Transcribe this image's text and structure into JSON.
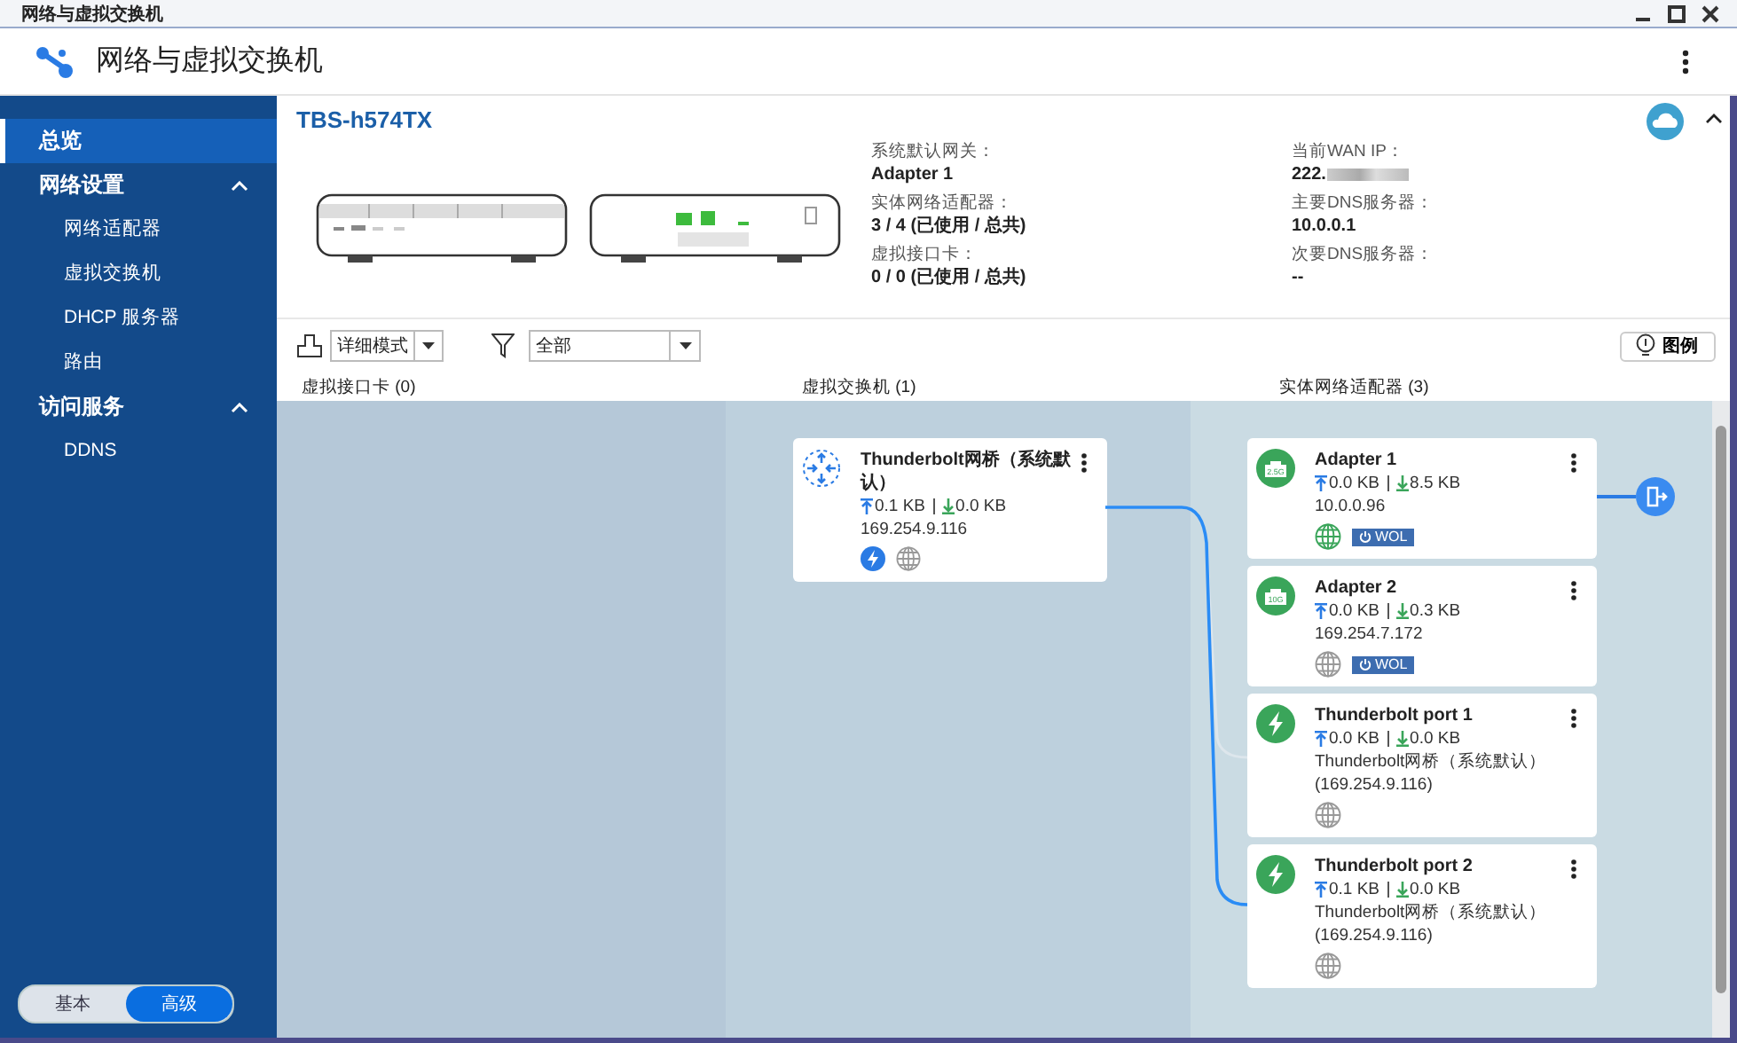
{
  "window": {
    "title": "网络与虚拟交换机"
  },
  "app": {
    "title": "网络与虚拟交换机"
  },
  "sidebar": {
    "items": [
      {
        "label": "总览",
        "selected": true
      },
      {
        "label": "网络设置",
        "selected": false,
        "expanded": true,
        "children": [
          {
            "label": "网络适配器",
            "selected": false
          },
          {
            "label": "虚拟交换机",
            "selected": false
          },
          {
            "label": "DHCP 服务器",
            "selected": false
          },
          {
            "label": "路由",
            "selected": false
          }
        ]
      },
      {
        "label": "访问服务",
        "selected": false,
        "expanded": true,
        "children": [
          {
            "label": "DDNS",
            "selected": false
          }
        ]
      }
    ],
    "mode_toggle": [
      {
        "label": "基本",
        "selected": false
      },
      {
        "label": "高级",
        "selected": true
      }
    ]
  },
  "device": {
    "name": "TBS-h574TX",
    "info": [
      {
        "label": "系统默认网关：",
        "value": "Adapter 1",
        "blurred": false
      },
      {
        "label": "当前WAN IP：",
        "value": "222.",
        "blurred": true
      },
      {
        "label": "实体网络适配器：",
        "value": "3 / 4 (已使用 / 总共)",
        "blurred": false
      },
      {
        "label": "主要DNS服务器：",
        "value": "10.0.0.1",
        "blurred": false
      },
      {
        "label": "虚拟接口卡：",
        "value": "0 / 0 (已使用 / 总共)",
        "blurred": false
      },
      {
        "label": "次要DNS服务器：",
        "value": "--",
        "blurred": false
      }
    ]
  },
  "toolbar": {
    "view_mode": "详细模式",
    "filter": "全部",
    "legend_button": "图例"
  },
  "columns": [
    "虚拟接口卡 (0)",
    "虚拟交换机 (1)",
    "实体网络适配器 (3)"
  ],
  "switch": {
    "name": "Thunderbolt网桥（系统默认）",
    "upload": "0.1 KB",
    "download": "0.0 KB",
    "ip": "169.254.9.116"
  },
  "adapters": [
    {
      "name": "Adapter 1",
      "kind": "ethernet",
      "port_label": "2.5G",
      "upload": "0.0 KB",
      "download": "8.5 KB",
      "ip": "10.0.0.96",
      "internet": true,
      "wol": "WOL",
      "gateway": true
    },
    {
      "name": "Adapter 2",
      "kind": "ethernet",
      "port_label": "10G",
      "upload": "0.0 KB",
      "download": "0.3 KB",
      "ip": "169.254.7.172",
      "internet": false,
      "wol": "WOL",
      "gateway": false
    },
    {
      "name": "Thunderbolt port 1",
      "kind": "thunderbolt",
      "upload": "0.0 KB",
      "download": "0.0 KB",
      "ip": "Thunderbolt网桥（系统默认）(169.254.9.116)",
      "internet": false,
      "gateway": false
    },
    {
      "name": "Thunderbolt port 2",
      "kind": "thunderbolt",
      "upload": "0.1 KB",
      "download": "0.0 KB",
      "ip": "Thunderbolt网桥（系统默认）(169.254.9.116)",
      "internet": false,
      "gateway": false
    }
  ]
}
